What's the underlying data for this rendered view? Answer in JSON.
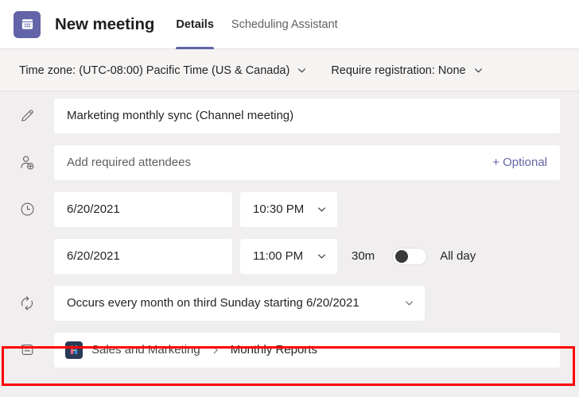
{
  "header": {
    "app_icon": "calendar-icon",
    "title": "New meeting",
    "tabs": [
      {
        "label": "Details",
        "active": true
      },
      {
        "label": "Scheduling Assistant",
        "active": false
      }
    ],
    "accent_color": "#6264a7"
  },
  "options_bar": {
    "timezone": "Time zone: (UTC-08:00) Pacific Time (US & Canada)",
    "registration": "Require registration: None",
    "chevron_icon": "chevron-down-icon"
  },
  "form": {
    "title_row": {
      "icon": "pencil-icon",
      "value": "Marketing monthly sync (Channel meeting)"
    },
    "attendees_row": {
      "icon": "person-add-icon",
      "placeholder": "Add required attendees",
      "optional_label": "+ Optional",
      "optional_color": "#6264a7"
    },
    "start_row": {
      "icon": "clock-icon",
      "date": "6/20/2021",
      "time": "10:30 PM",
      "chevron_icon": "chevron-down-icon"
    },
    "end_row": {
      "date": "6/20/2021",
      "time": "11:00 PM",
      "chevron_icon": "chevron-down-icon",
      "duration": "30m",
      "all_day_label": "All day",
      "all_day_on": false
    },
    "recurrence_row": {
      "icon": "repeat-icon",
      "value": "Occurs every month on third Sunday starting 6/20/2021",
      "chevron_icon": "chevron-down-icon"
    },
    "channel_row": {
      "icon": "channel-icon",
      "team_avatar": "team-avatar-icon",
      "team": "Sales and Marketing",
      "separator_icon": "chevron-right-icon",
      "channel": "Monthly Reports",
      "highlight_color": "#ff0000"
    }
  }
}
